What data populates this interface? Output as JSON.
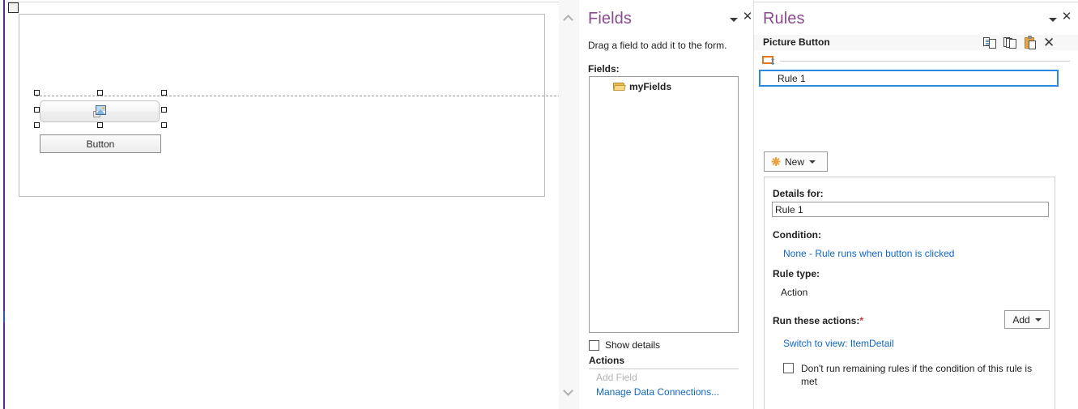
{
  "canvas": {
    "layout_handle_name": "table-select-handle",
    "picture_button": {
      "icon": "picture-icon",
      "label": ""
    },
    "plain_button": {
      "label": "Button"
    }
  },
  "fields_pane": {
    "title": "Fields",
    "caret_icon": "chevron-down-icon",
    "close_icon": "close-icon",
    "hint": "Drag a field to add it to the form.",
    "list_label": "Fields:",
    "tree": [
      {
        "label": "myFields",
        "icon": "folder-icon"
      }
    ],
    "show_details": {
      "label": "Show details",
      "checked": false
    },
    "actions_heading": "Actions",
    "actions": [
      {
        "label": "Add Field",
        "enabled": false
      },
      {
        "label": "Manage Data Connections...",
        "enabled": true
      }
    ]
  },
  "rules_pane": {
    "title": "Rules",
    "caret_icon": "chevron-down-icon",
    "close_icon": "close-icon",
    "context_label": "Picture Button",
    "toolbar": [
      {
        "name": "copy-rule-button",
        "tooltip": "Copy Rule",
        "icon": "copy-icon"
      },
      {
        "name": "copy-all-rules-button",
        "tooltip": "Copy All Rules",
        "icon": "copy-all-icon"
      },
      {
        "name": "paste-rule-button",
        "tooltip": "Paste Rule",
        "icon": "paste-icon"
      },
      {
        "name": "delete-rule-button",
        "tooltip": "Delete",
        "icon": "close-x-icon"
      }
    ],
    "column_header_icon": "rule-column-icon",
    "rules_list": [
      {
        "label": "Rule 1",
        "selected": true
      }
    ],
    "new_button": {
      "label": "New",
      "icon": "sparkle-icon",
      "caret_icon": "chevron-down-icon"
    },
    "details": {
      "details_for_label": "Details for:",
      "rule_name_value": "Rule 1",
      "condition_label": "Condition:",
      "condition_value": "None - Rule runs when button is clicked",
      "rule_type_label": "Rule type:",
      "rule_type_value": "Action",
      "actions_label": "Run these actions:",
      "actions_required_marker": "*",
      "add_button_label": "Add",
      "add_button_caret": "chevron-down-icon",
      "action_items": [
        {
          "label": "Switch to view: ItemDetail"
        }
      ],
      "dont_run_checkbox": {
        "label": "Don't run remaining rules if the condition of this rule is met",
        "checked": false
      }
    }
  },
  "scrollbars": {
    "center": {
      "up_icon": "chevron-up-icon",
      "down_icon": "chevron-down-icon"
    }
  },
  "colors": {
    "pane_title": "#8a4b8e",
    "link": "#1168c4",
    "selection": "#2b8ae0",
    "accent_orange": "#e07a20",
    "left_marker": "#5b2d82"
  }
}
